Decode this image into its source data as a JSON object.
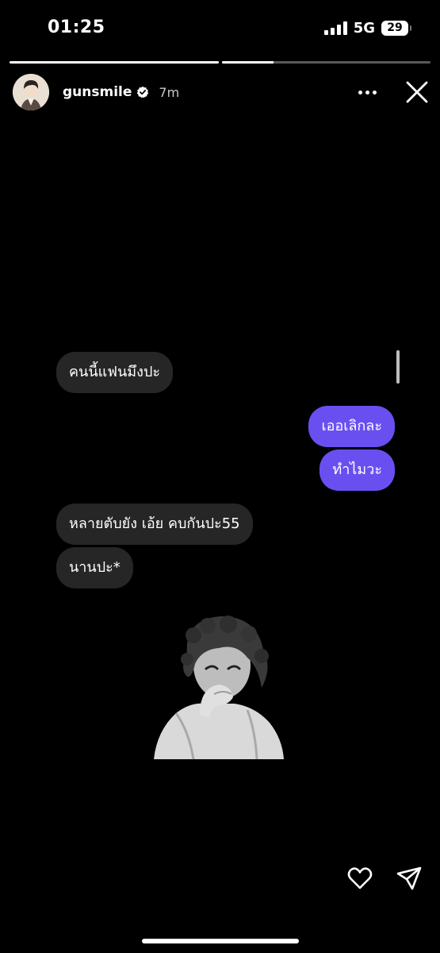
{
  "status_bar": {
    "time": "01:25",
    "network": "5G",
    "battery": "29"
  },
  "story": {
    "progress": [
      1.0,
      0.25
    ],
    "username": "gunsmile",
    "verified": true,
    "time_ago": "7m"
  },
  "messages": [
    {
      "text": "คนนี้แฟนมึงปะ",
      "side": "incoming"
    },
    {
      "text": "เออเลิกละ",
      "side": "outgoing"
    },
    {
      "text": "ทำไมวะ",
      "side": "outgoing"
    },
    {
      "text": "หลายตับยัง เอ้ย คบกันปะ55",
      "side": "incoming"
    },
    {
      "text": "นานปะ*",
      "side": "incoming"
    }
  ],
  "icons": {
    "more": "more-dots-icon",
    "close": "close-icon",
    "like": "heart-icon",
    "share": "send-icon",
    "verified": "verified-badge-icon"
  },
  "colors": {
    "outgoing_bubble": "#6a4ff0",
    "incoming_bubble": "#262626",
    "background": "#000000"
  }
}
